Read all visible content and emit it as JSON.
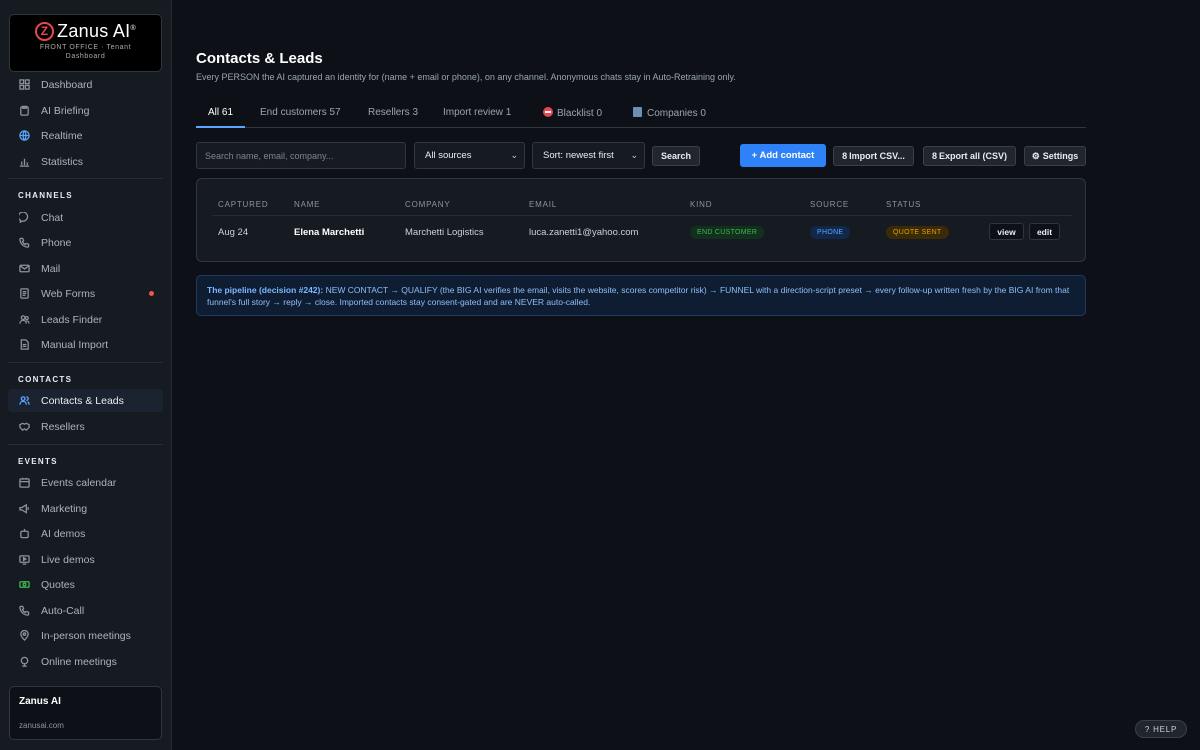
{
  "brand": {
    "name": "Zanus AI",
    "mark": "Z",
    "sub1": "FRONT OFFICE · Tenant",
    "sub2": "Dashboard"
  },
  "sidebar": {
    "top": [
      {
        "label": "Dashboard",
        "icon": "grid-icon"
      },
      {
        "label": "AI Briefing",
        "icon": "clipboard-icon"
      },
      {
        "label": "Realtime",
        "icon": "globe-icon"
      },
      {
        "label": "Statistics",
        "icon": "bar-chart-icon"
      }
    ],
    "channels_title": "CHANNELS",
    "channels": [
      {
        "label": "Chat",
        "icon": "chat-icon"
      },
      {
        "label": "Phone",
        "icon": "phone-icon"
      },
      {
        "label": "Mail",
        "icon": "mail-icon"
      },
      {
        "label": "Web Forms",
        "icon": "form-icon"
      },
      {
        "label": "Leads Finder",
        "icon": "people-icon"
      },
      {
        "label": "Manual Import",
        "icon": "document-icon"
      }
    ],
    "contacts_title": "CONTACTS",
    "contacts": [
      {
        "label": "Contacts & Leads",
        "icon": "users-icon"
      },
      {
        "label": "Resellers",
        "icon": "handshake-icon"
      }
    ],
    "events_title": "EVENTS",
    "events": [
      {
        "label": "Events calendar",
        "icon": "calendar-icon"
      },
      {
        "label": "Marketing",
        "icon": "megaphone-icon"
      },
      {
        "label": "AI demos",
        "icon": "robot-icon"
      },
      {
        "label": "Live demos",
        "icon": "video-icon"
      },
      {
        "label": "Quotes",
        "icon": "money-icon"
      },
      {
        "label": "Auto-Call",
        "icon": "phone-icon"
      },
      {
        "label": "In-person meetings",
        "icon": "pin-icon"
      },
      {
        "label": "Online meetings",
        "icon": "globe-pin-icon"
      }
    ],
    "tenant": {
      "name": "Zanus AI",
      "url": "zanusai.com"
    }
  },
  "page": {
    "title": "Contacts & Leads",
    "subtitle": "Every PERSON the AI captured an identity for (name + email or phone), on any channel. Anonymous chats stay in Auto-Retraining only."
  },
  "tabs": [
    {
      "label": "All 61"
    },
    {
      "label": "End customers 57"
    },
    {
      "label": "Resellers 3"
    },
    {
      "label": "Import review 1"
    },
    {
      "label": "Blacklist 0",
      "icon": "no-entry-icon"
    },
    {
      "label": "Companies 0",
      "icon": "building-icon"
    }
  ],
  "toolbar": {
    "search_placeholder": "Search name, email, company...",
    "source_select": "All sources",
    "sort_select": "Sort: newest first",
    "search_btn": "Search",
    "add_btn": "+ Add contact",
    "import_btn": "Import CSV...",
    "export_btn": "Export all (CSV)",
    "settings_btn": "Settings"
  },
  "table": {
    "headers": [
      "CAPTURED",
      "NAME",
      "COMPANY",
      "EMAIL",
      "KIND",
      "SOURCE",
      "STATUS"
    ],
    "rows": [
      {
        "captured": "Aug 24",
        "name": "Elena Marchetti",
        "company": "Marchetti Logistics",
        "email": "luca.zanetti1@yahoo.com",
        "kind": "END CUSTOMER",
        "source": "PHONE",
        "status": "QUOTE SENT",
        "view": "view",
        "edit": "edit"
      }
    ]
  },
  "pipeline": {
    "lead": "The pipeline (decision #242):",
    "text": " NEW CONTACT → QUALIFY (the BIG AI verifies the email, visits the website, scores competitor risk) → FUNNEL with a direction-script preset → every follow-up written fresh by the BIG AI from that funnel's full story → reply → close. Imported contacts stay consent-gated and are NEVER auto-called."
  },
  "help": "? HELP",
  "colors": {
    "accent": "#2f81f7",
    "bg": "#0d1117",
    "sidebar": "#161b22",
    "green": "#3fb950",
    "amber": "#e3a008",
    "red": "#f85149"
  }
}
